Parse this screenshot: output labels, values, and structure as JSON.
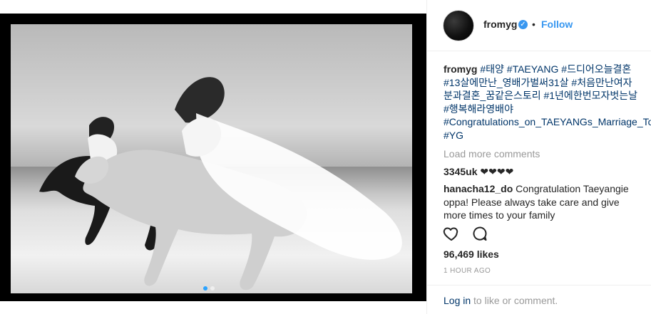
{
  "post": {
    "carousel": {
      "count": 2,
      "active_index": 0
    }
  },
  "header": {
    "username": "fromyg",
    "verified": "✓",
    "bullet": "•",
    "follow_label": "Follow"
  },
  "caption": {
    "username": "fromyg",
    "tags": [
      "#태양",
      "#TAEYANG",
      "#드디어오늘결혼",
      "#13살에만난_영배가벌써31살",
      "#처음만난여자분과결혼_꿈같은스토리",
      "#1년에한번모자벗는날",
      "#행복해라영배야",
      "#Congratulations_on_TAEYANGs_Marriage_Today",
      "#YG"
    ]
  },
  "load_more_label": "Load more comments",
  "comments": [
    {
      "username": "3345uk",
      "text": "❤❤❤❤"
    },
    {
      "username": "hanacha12_do",
      "text": "Congratulation Taeyangie oppa! Please always take care and give more times to your family"
    }
  ],
  "likes_label": "96,469 likes",
  "time_label": "1 HOUR AGO",
  "footer": {
    "login_link": "Log in",
    "login_rest": " to like or comment."
  }
}
